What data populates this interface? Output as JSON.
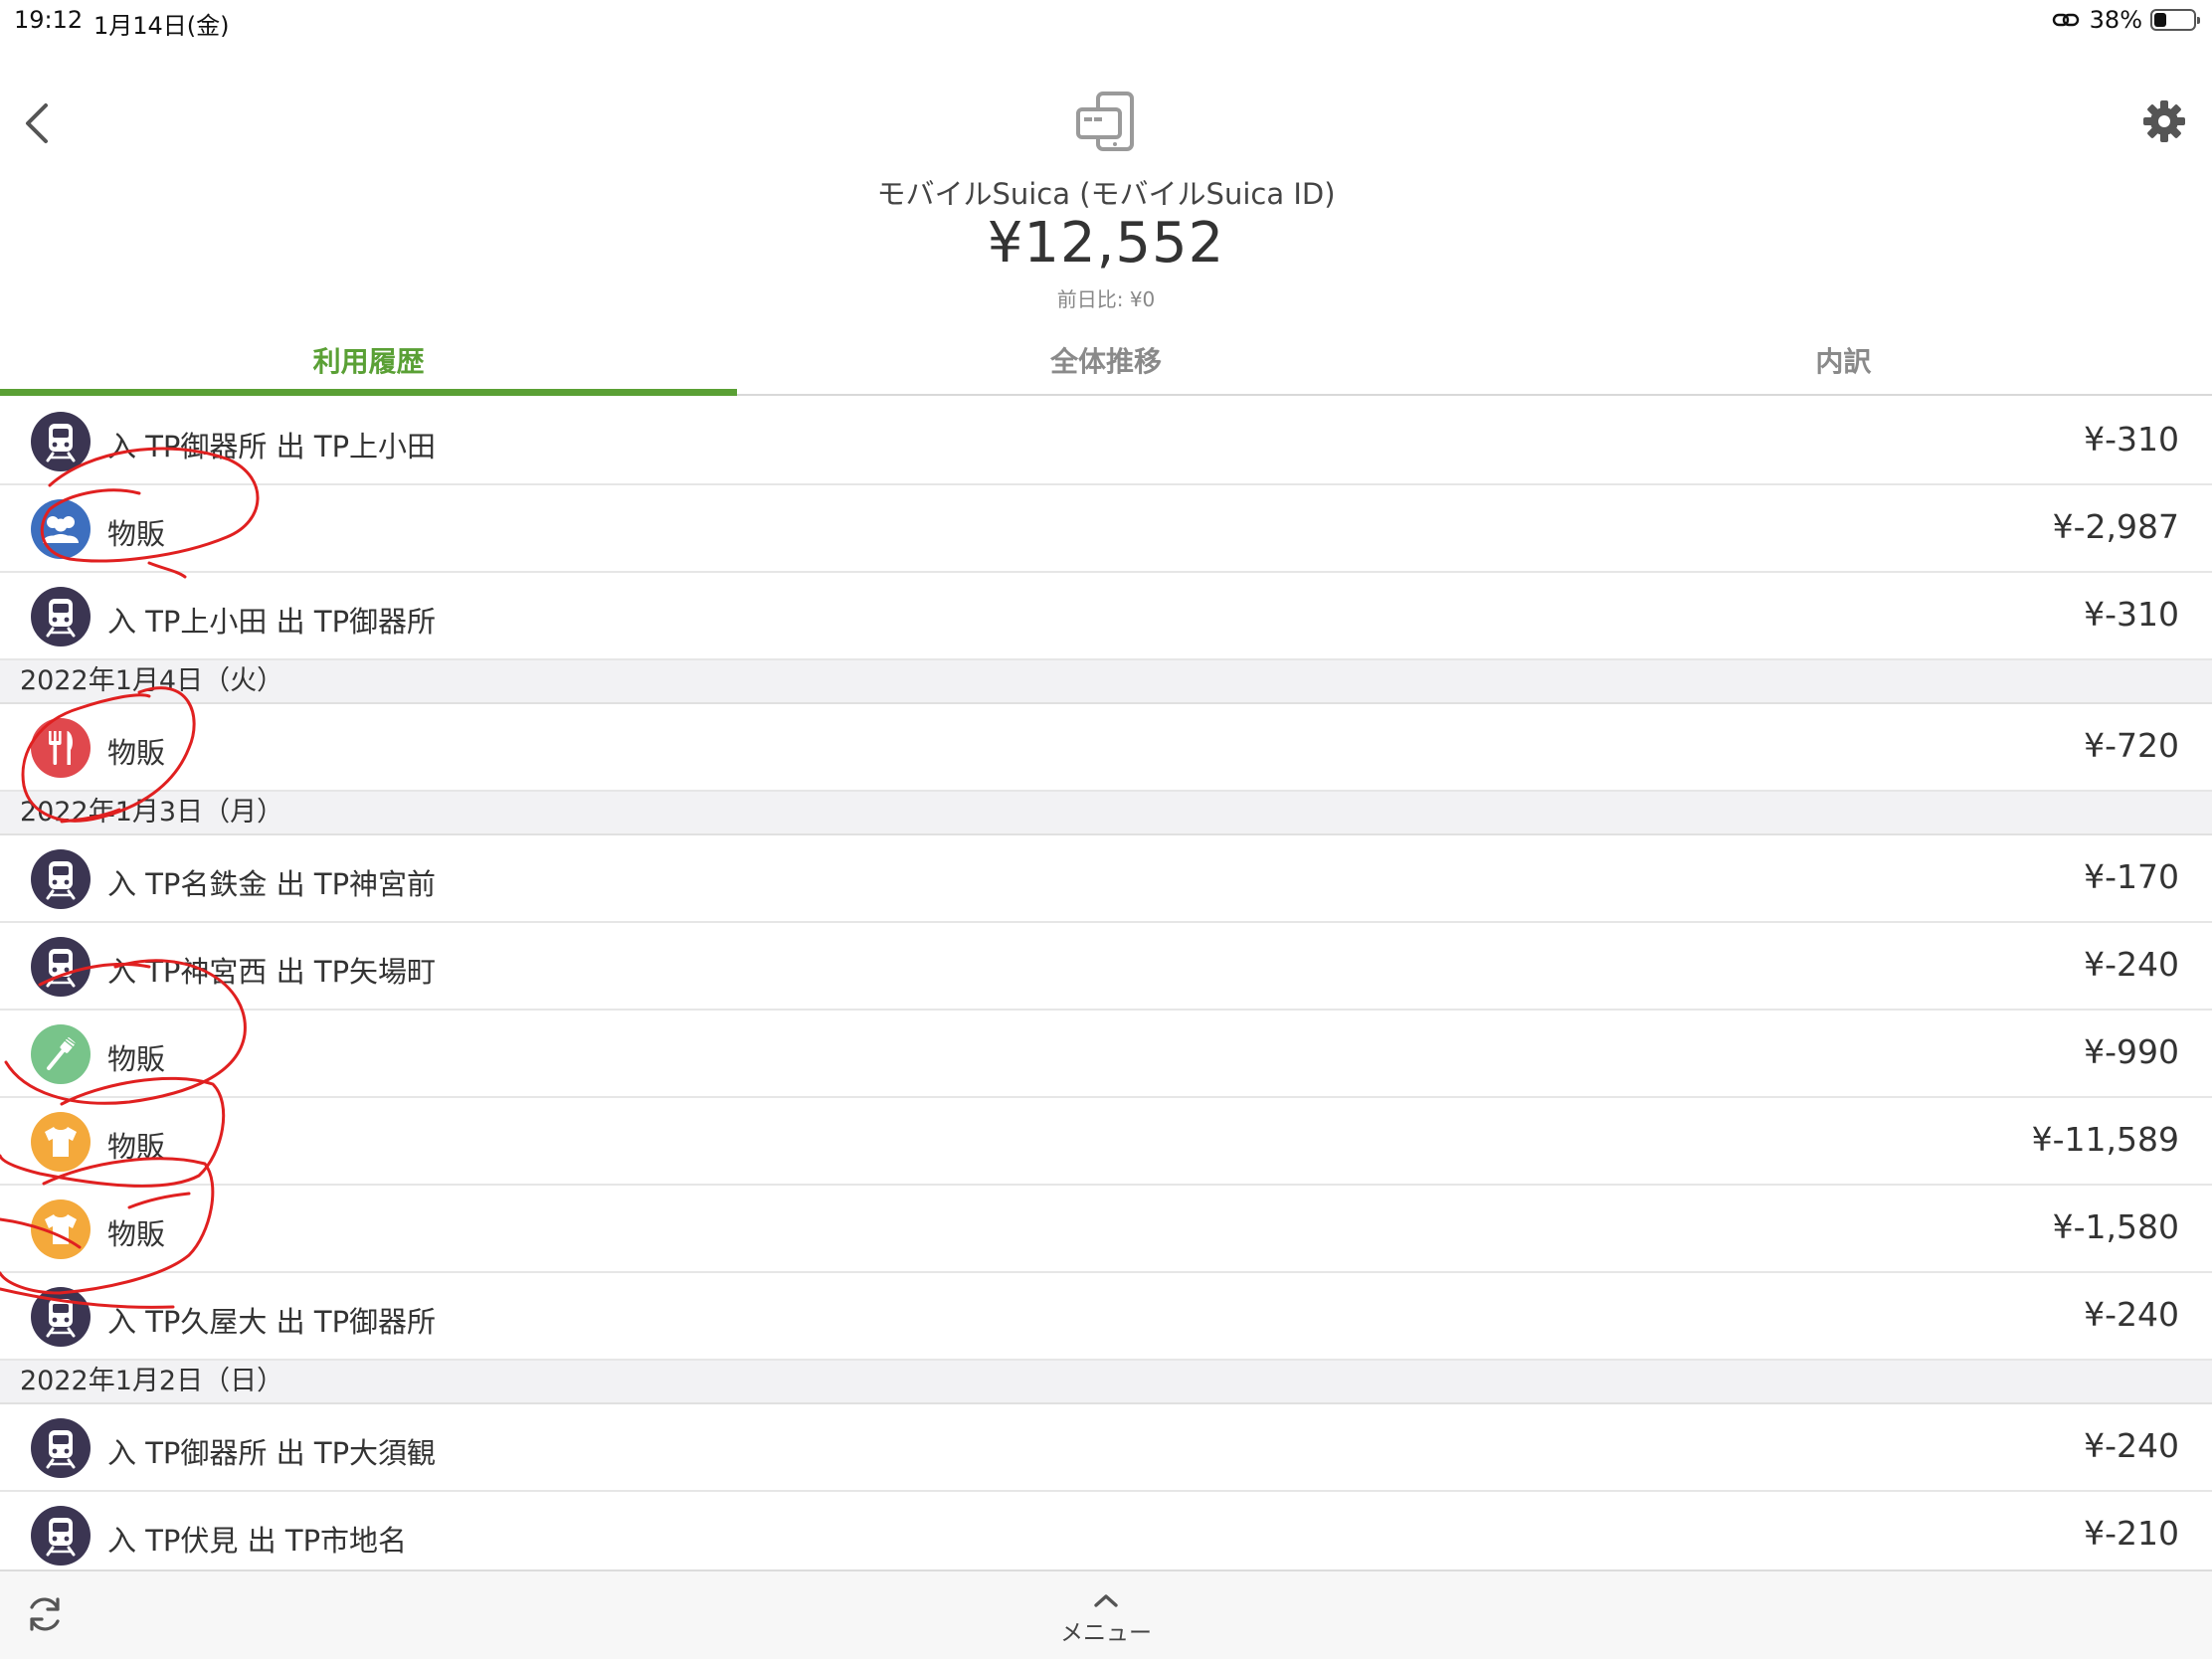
{
  "status_bar": {
    "time": "19:12",
    "date": "1月14日(金)",
    "battery": "38%",
    "battery_level": 0.38
  },
  "header": {
    "account_name": "モバイルSuica (モバイルSuica ID)",
    "balance": "¥12,552",
    "diff": "前日比: ¥0"
  },
  "tabs": [
    {
      "label": "利用履歴",
      "active": true
    },
    {
      "label": "全体推移",
      "active": false
    },
    {
      "label": "内訳",
      "active": false
    }
  ],
  "history": {
    "rows_top": [
      {
        "icon": "train-icon",
        "label": "入 TP御器所 出 TP上小田",
        "amount": "¥-310"
      },
      {
        "icon": "people-icon",
        "label": "物販",
        "amount": "¥-2,987"
      },
      {
        "icon": "train-icon",
        "label": "入 TP上小田 出 TP御器所",
        "amount": "¥-310"
      }
    ],
    "date_1": "2022年1月4日（火）",
    "rows_date_1": [
      {
        "icon": "fork-knife-icon",
        "label": "物販",
        "amount": "¥-720"
      }
    ],
    "date_2": "2022年1月3日（月）",
    "rows_date_2": [
      {
        "icon": "train-icon",
        "label": "入 TP名鉄金 出 TP神宮前",
        "amount": "¥-170"
      },
      {
        "icon": "train-icon",
        "label": "入 TP神宮西 出 TP矢場町",
        "amount": "¥-240"
      },
      {
        "icon": "toothbrush-icon",
        "label": "物販",
        "amount": "¥-990"
      },
      {
        "icon": "shirt-icon",
        "label": "物販",
        "amount": "¥-11,589"
      },
      {
        "icon": "shirt-icon",
        "label": "物販",
        "amount": "¥-1,580"
      },
      {
        "icon": "train-icon",
        "label": "入 TP久屋大 出 TP御器所",
        "amount": "¥-240"
      }
    ],
    "date_3": "2022年1月2日（日）",
    "rows_date_3": [
      {
        "icon": "train-icon",
        "label": "入 TP御器所 出 TP大須観",
        "amount": "¥-240"
      },
      {
        "icon": "train-icon",
        "label": "入 TP伏見 出 TP市地名",
        "amount": "¥-210"
      }
    ]
  },
  "bottom_bar": {
    "menu_label": "メニュー"
  },
  "colors": {
    "accent": "#5aa035",
    "train": "#3b3552",
    "people": "#3d6fbf",
    "food": "#e0484d",
    "tool": "#78c48a",
    "shirt": "#f4a93b",
    "annotation": "#e02020"
  }
}
